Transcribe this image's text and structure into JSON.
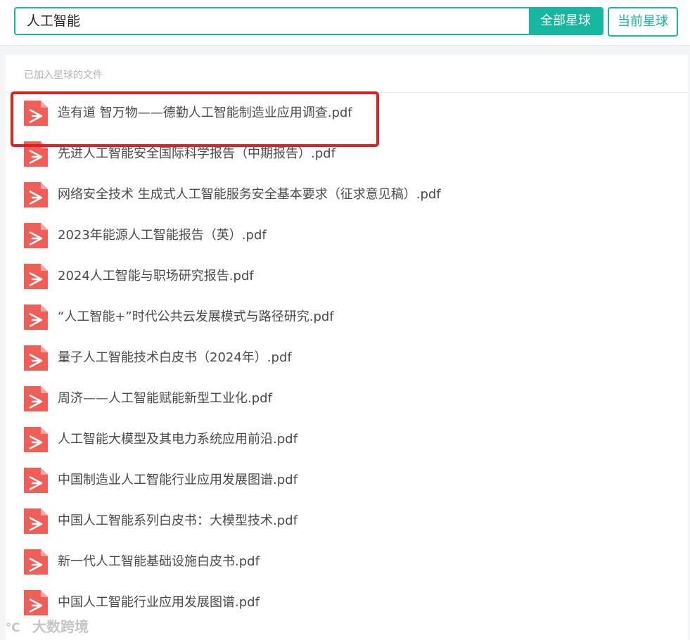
{
  "search": {
    "value": "人工智能",
    "all_planets_label": "全部星球",
    "current_planet_label": "当前星球"
  },
  "files_section": {
    "title": "已加入星球的文件",
    "icon": "pdf-file-icon",
    "icon_color": "#ef5f58",
    "items": [
      {
        "name": "造有道 智万物——德勤人工智能制造业应用调查.pdf"
      },
      {
        "name": "先进人工智能安全国际科学报告（中期报告）.pdf"
      },
      {
        "name": "网络安全技术 生成式人工智能服务安全基本要求（征求意见稿）.pdf"
      },
      {
        "name": "2023年能源人工智能报告（英）.pdf"
      },
      {
        "name": "2024人工智能与职场研究报告.pdf"
      },
      {
        "name": "“人工智能+”时代公共云发展模式与路径研究.pdf"
      },
      {
        "name": "量子人工智能技术白皮书（2024年）.pdf"
      },
      {
        "name": "周济——人工智能赋能新型工业化.pdf"
      },
      {
        "name": "人工智能大模型及其电力系统应用前沿.pdf"
      },
      {
        "name": "中国制造业人工智能行业应用发展图谱.pdf"
      },
      {
        "name": "中国人工智能系列白皮书：大模型技术.pdf"
      },
      {
        "name": "新一代人工智能基础设施白皮书.pdf"
      },
      {
        "name": "中国人工智能行业应用发展图谱.pdf"
      }
    ]
  },
  "highlight": {
    "color": "#e02020"
  },
  "watermark": {
    "logo": "℃",
    "text": "大数跨境"
  },
  "colors": {
    "accent": "#17b69e"
  }
}
